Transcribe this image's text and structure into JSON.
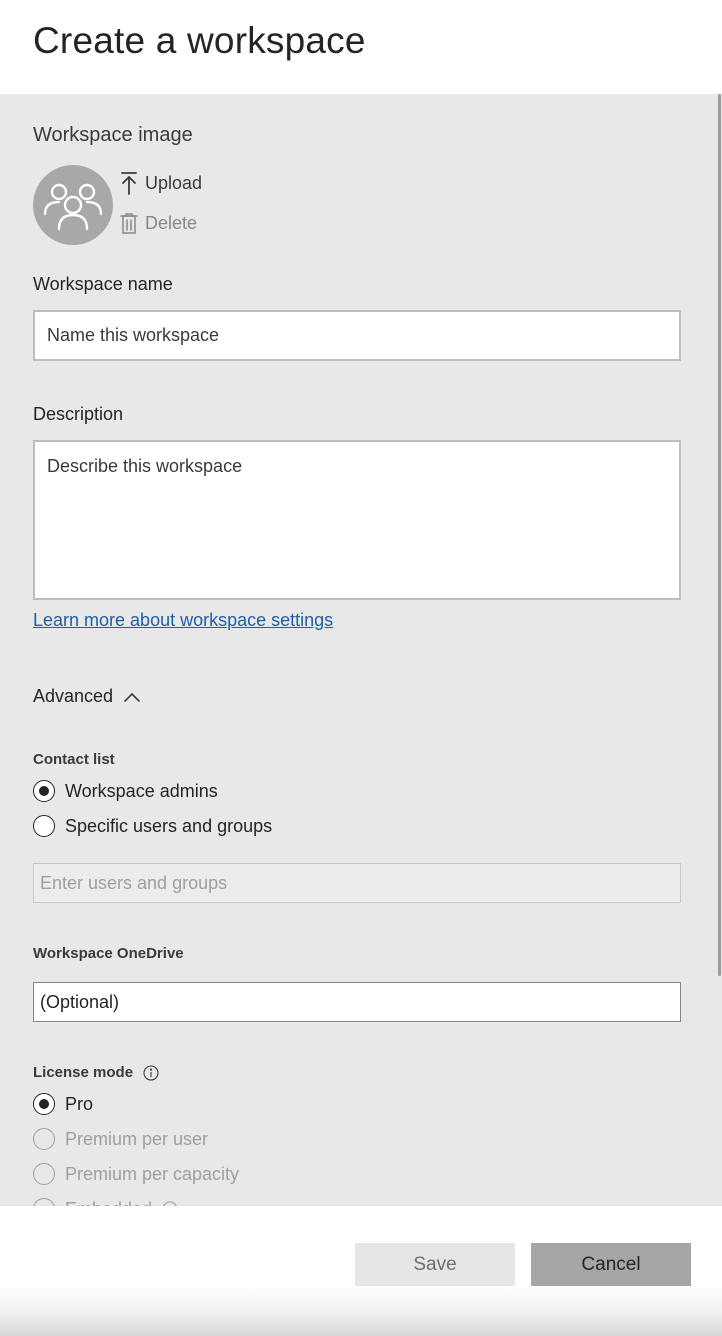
{
  "header": {
    "title": "Create a workspace"
  },
  "workspace_image": {
    "title": "Workspace image",
    "avatar_icon": "people-group-icon",
    "upload_label": "Upload",
    "delete_label": "Delete"
  },
  "workspace_name": {
    "label": "Workspace name",
    "placeholder": "Name this workspace"
  },
  "description": {
    "label": "Description",
    "placeholder": "Describe this workspace"
  },
  "learn_more_link": "Learn more about workspace settings",
  "advanced": {
    "label": "Advanced",
    "expanded": true
  },
  "contact_list": {
    "label": "Contact list",
    "options": [
      {
        "label": "Workspace admins",
        "selected": true
      },
      {
        "label": "Specific users and groups",
        "selected": false
      }
    ],
    "users_placeholder": "Enter users and groups"
  },
  "onedrive": {
    "label": "Workspace OneDrive",
    "value": "(Optional)"
  },
  "license_mode": {
    "label": "License mode",
    "options": [
      {
        "label": "Pro",
        "selected": true,
        "disabled": false
      },
      {
        "label": "Premium per user",
        "selected": false,
        "disabled": true
      },
      {
        "label": "Premium per capacity",
        "selected": false,
        "disabled": true
      },
      {
        "label": "Embedded",
        "selected": false,
        "disabled": true
      }
    ]
  },
  "footer": {
    "save_label": "Save",
    "cancel_label": "Cancel"
  },
  "colors": {
    "link": "#1f5ea8",
    "panel_bg": "#e8e8e8",
    "cancel_bg": "#a6a6a6",
    "save_bg": "#e6e6e6"
  }
}
